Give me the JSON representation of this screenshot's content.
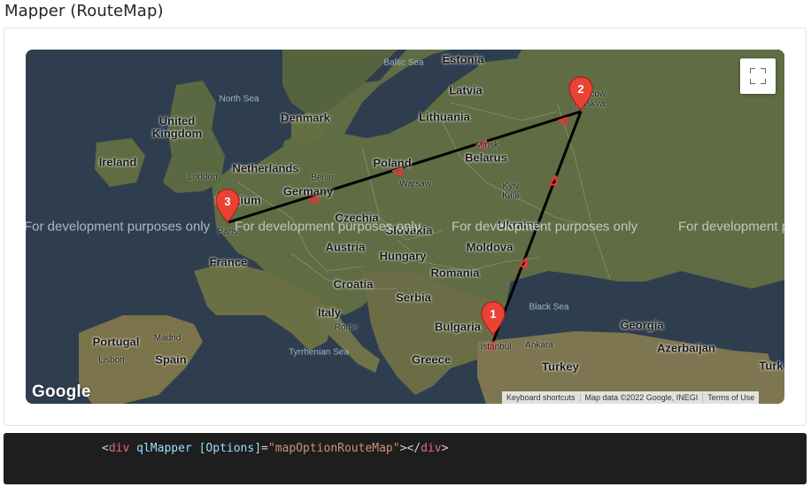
{
  "page": {
    "title": "Mapper (RouteMap)"
  },
  "map": {
    "watermark": "For development purposes only",
    "fullscreen_icon": "fullscreen-icon",
    "google_logo": "Google",
    "attribution": {
      "keyboard": "Keyboard shortcuts",
      "map_data": "Map data ©2022 Google, INEGI",
      "terms": "Terms of Use"
    },
    "countries": [
      {
        "id": "estonia",
        "label": "Estonia"
      },
      {
        "id": "latvia",
        "label": "Latvia"
      },
      {
        "id": "lithuania",
        "label": "Lithuania"
      },
      {
        "id": "denmark",
        "label": "Denmark"
      },
      {
        "id": "uk",
        "label": "United\nKingdom"
      },
      {
        "id": "ireland",
        "label": "Ireland"
      },
      {
        "id": "netherlands",
        "label": "Netherlands"
      },
      {
        "id": "belgium",
        "label": "Belgium"
      },
      {
        "id": "germany",
        "label": "Germany"
      },
      {
        "id": "poland",
        "label": "Poland"
      },
      {
        "id": "belarus",
        "label": "Belarus"
      },
      {
        "id": "czechia",
        "label": "Czechia"
      },
      {
        "id": "ukraine",
        "label": "Ukraine"
      },
      {
        "id": "slovakia",
        "label": "Slovakia"
      },
      {
        "id": "austria",
        "label": "Austria"
      },
      {
        "id": "hungary",
        "label": "Hungary"
      },
      {
        "id": "moldova",
        "label": "Moldova"
      },
      {
        "id": "france",
        "label": "France"
      },
      {
        "id": "romania",
        "label": "Romania"
      },
      {
        "id": "croatia",
        "label": "Croatia"
      },
      {
        "id": "serbia",
        "label": "Serbia"
      },
      {
        "id": "italy",
        "label": "Italy"
      },
      {
        "id": "bulgaria",
        "label": "Bulgaria"
      },
      {
        "id": "georgia",
        "label": "Georgia"
      },
      {
        "id": "portugal",
        "label": "Portugal"
      },
      {
        "id": "spain",
        "label": "Spain"
      },
      {
        "id": "azerbaijan",
        "label": "Azerbaijan"
      },
      {
        "id": "greece",
        "label": "Greece"
      },
      {
        "id": "turkey",
        "label": "Turkey"
      },
      {
        "id": "turk2",
        "label": "Turk"
      }
    ],
    "cities": [
      {
        "id": "moskva",
        "label": "Moscow\nMoskva"
      },
      {
        "id": "london",
        "label": "London"
      },
      {
        "id": "berlin",
        "label": "Berlin"
      },
      {
        "id": "warsaw",
        "label": "Warsaw"
      },
      {
        "id": "minsk",
        "label": "Minsk"
      },
      {
        "id": "kyiv",
        "label": "Kyiv\nКиїв"
      },
      {
        "id": "paris",
        "label": "Paris"
      },
      {
        "id": "rome",
        "label": "Rome"
      },
      {
        "id": "madrid",
        "label": "Madrid"
      },
      {
        "id": "lisbon",
        "label": "Lisbon"
      },
      {
        "id": "istanbul",
        "label": "İstanbul"
      },
      {
        "id": "ankara",
        "label": "Ankara"
      }
    ],
    "seas": [
      {
        "id": "baltic",
        "label": "Baltic Sea"
      },
      {
        "id": "north",
        "label": "North Sea"
      },
      {
        "id": "black",
        "label": "Black Sea"
      },
      {
        "id": "tyrrhenian",
        "label": "Tyrrhenian Sea"
      }
    ],
    "markers": [
      {
        "id": "istanbul",
        "label": "1",
        "color": "#ea4335"
      },
      {
        "id": "moscow",
        "label": "2",
        "color": "#ea4335"
      },
      {
        "id": "paris",
        "label": "3",
        "color": "#ea4335"
      }
    ],
    "route_color": "#000000",
    "arrow_color": "#e8333a"
  },
  "code": {
    "open_lt": "<",
    "tag": "div",
    "attr1": " qlMapper ",
    "attr2": "[Options]",
    "eq": "=",
    "value": "\"mapOptionRouteMap\"",
    "close": "></",
    "end_tag": "div",
    "gt": ">"
  }
}
